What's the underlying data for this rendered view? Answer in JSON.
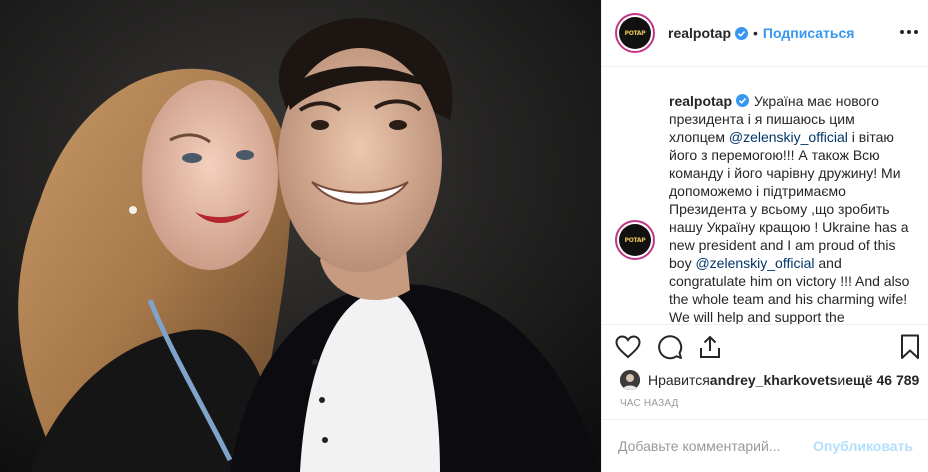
{
  "photo": {
    "description_icon": "photo-image"
  },
  "header": {
    "username": "realpotap",
    "separator": "•",
    "follow_label": "Подписаться",
    "avatar_text": "POTAP"
  },
  "caption": {
    "username": "realpotap",
    "part1": "Україна має нового президента і я пишаюсь цим хлопцем ",
    "mention1": "@zelenskiy_official",
    "part2": " і вітаю його з перемогою!!! А також Всю команду і його чарівну дружину! Ми допоможемо і підтримаємо Президента у всьому ,що зробить нашу Україну кращою ! Ukraine has a new president and I am proud of this boy ",
    "mention2": "@zelenskiy_official",
    "part3": " and congratulate him on victory !!! And also the whole team and his charming wife! We will help and support the"
  },
  "likes": {
    "prefix": "Нравится ",
    "user": "andrey_kharkovets",
    "middle": " и ",
    "count": "ещё 46 789"
  },
  "timestamp": "час назад",
  "comment_box": {
    "placeholder": "Добавьте комментарий...",
    "publish_label": "Опубликовать"
  },
  "colors": {
    "accent": "#3897f0",
    "mention": "#003569",
    "publish_disabled": "#b2dffc",
    "verified": "#3897f0"
  },
  "icons": [
    "heart-icon",
    "comment-icon",
    "share-icon",
    "bookmark-icon",
    "more-icon",
    "verified-icon"
  ]
}
